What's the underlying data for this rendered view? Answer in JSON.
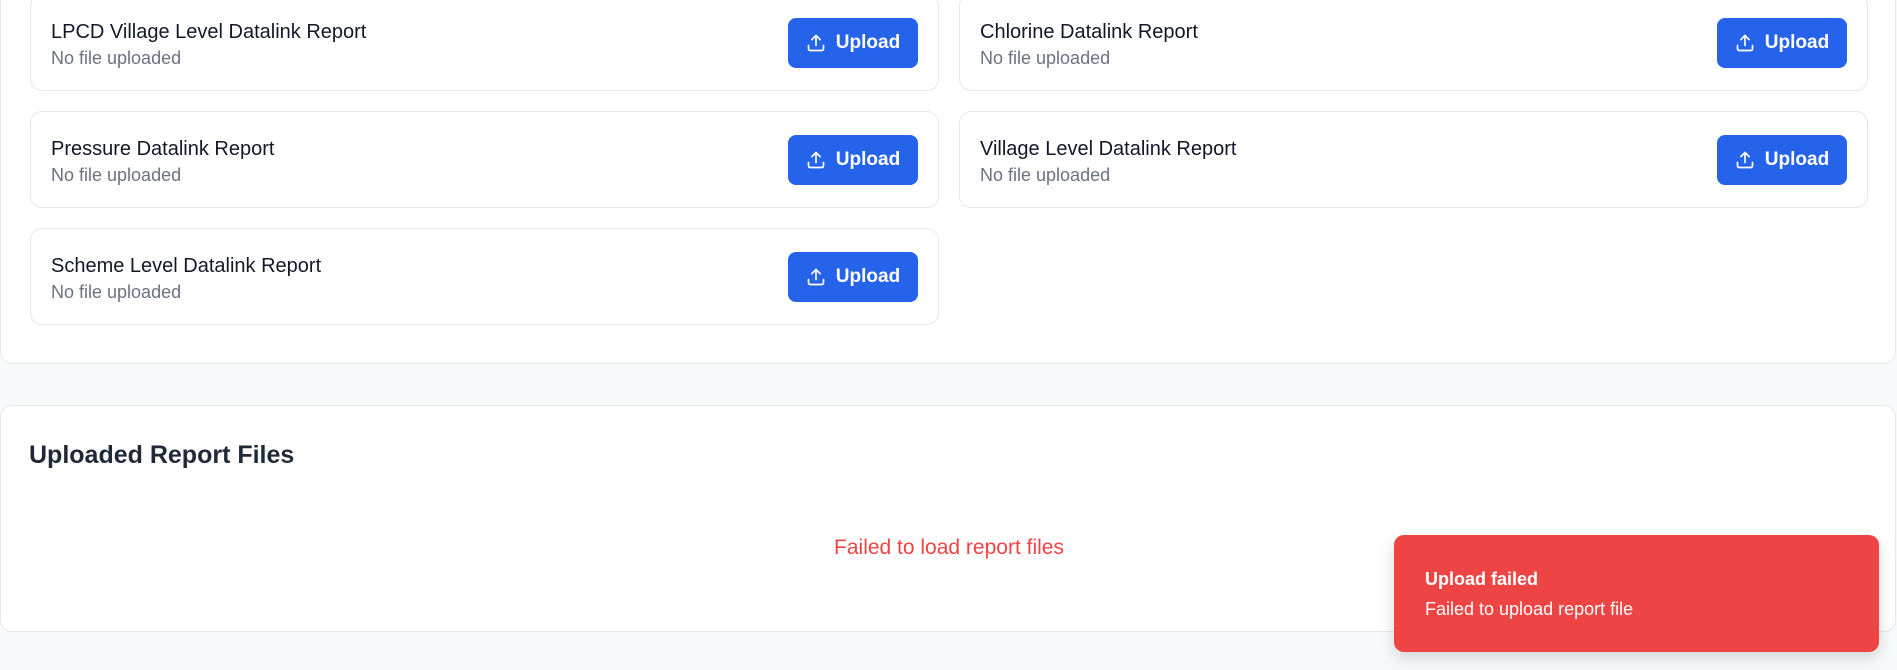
{
  "report_cards": [
    {
      "title": "LPCD Village Level Datalink Report",
      "status": "No file uploaded",
      "button_label": "Upload"
    },
    {
      "title": "Chlorine Datalink Report",
      "status": "No file uploaded",
      "button_label": "Upload"
    },
    {
      "title": "Pressure Datalink Report",
      "status": "No file uploaded",
      "button_label": "Upload"
    },
    {
      "title": "Village Level Datalink Report",
      "status": "No file uploaded",
      "button_label": "Upload"
    },
    {
      "title": "Scheme Level Datalink Report",
      "status": "No file uploaded",
      "button_label": "Upload"
    }
  ],
  "uploaded_section": {
    "title": "Uploaded Report Files",
    "error_message": "Failed to load report files"
  },
  "toast": {
    "title": "Upload failed",
    "message": "Failed to upload report file"
  },
  "colors": {
    "primary": "#2563eb",
    "error": "#ef4444",
    "muted_text": "#6b7280",
    "border": "#e5e7eb",
    "page_background": "#f8f9fb"
  },
  "icons": {
    "upload_button_icon": "upload-icon"
  }
}
